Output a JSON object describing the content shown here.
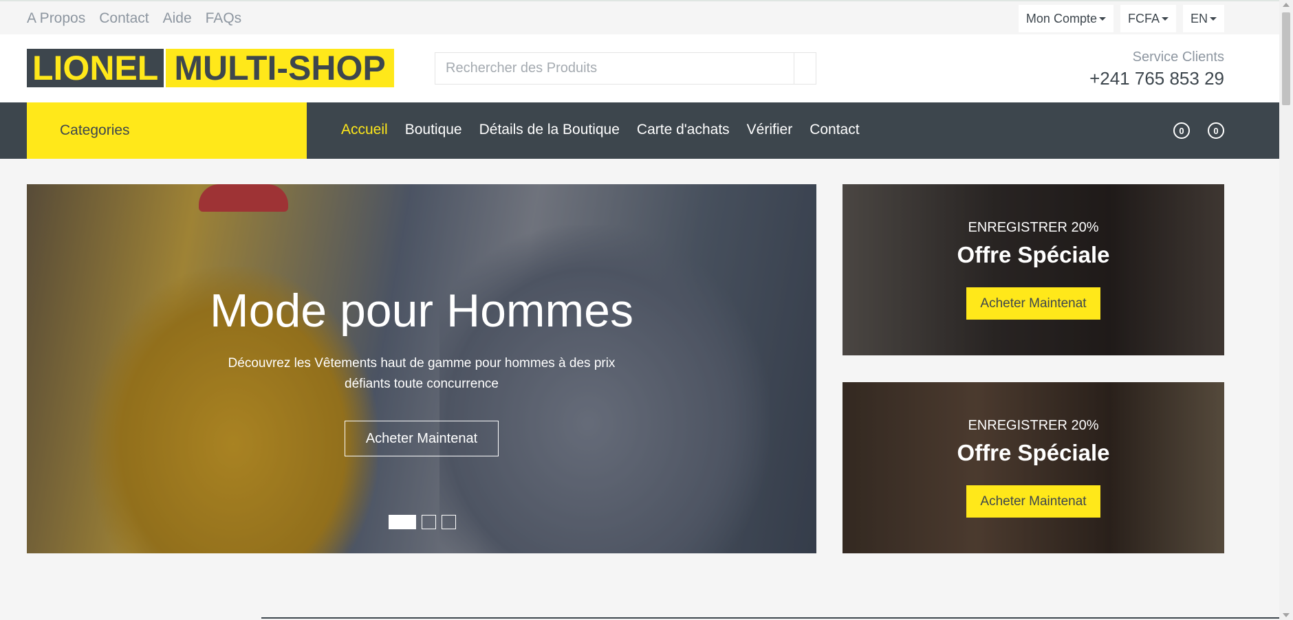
{
  "topbar": {
    "links": [
      "A Propos",
      "Contact",
      "Aide",
      "FAQs"
    ],
    "account": "Mon Compte",
    "currency": "FCFA",
    "language": "EN"
  },
  "header": {
    "logo_part1": "LIONEL",
    "logo_part2": "MULTI-SHOP",
    "search_placeholder": "Rechercher des Produits",
    "service_label": "Service Clients",
    "service_phone": "+241 765 853 29"
  },
  "navbar": {
    "categories": "Categories",
    "links": [
      "Accueil",
      "Boutique",
      "Détails de la Boutique",
      "Carte d'achats",
      "Vérifier",
      "Contact"
    ],
    "favorites_count": "0",
    "cart_count": "0"
  },
  "hero": {
    "title": "Mode pour Hommes",
    "subtitle": "Découvrez les Vêtements haut de gamme pour hommes à des prix défiants toute concurrence",
    "cta": "Acheter Maintenat"
  },
  "offers": [
    {
      "small": "ENREGISTRER 20%",
      "title": "Offre Spéciale",
      "cta": "Acheter Maintenat"
    },
    {
      "small": "ENREGISTRER 20%",
      "title": "Offre Spéciale",
      "cta": "Acheter Maintenat"
    }
  ],
  "colors": {
    "accent": "#ffe81a",
    "dark": "#3d464d"
  }
}
